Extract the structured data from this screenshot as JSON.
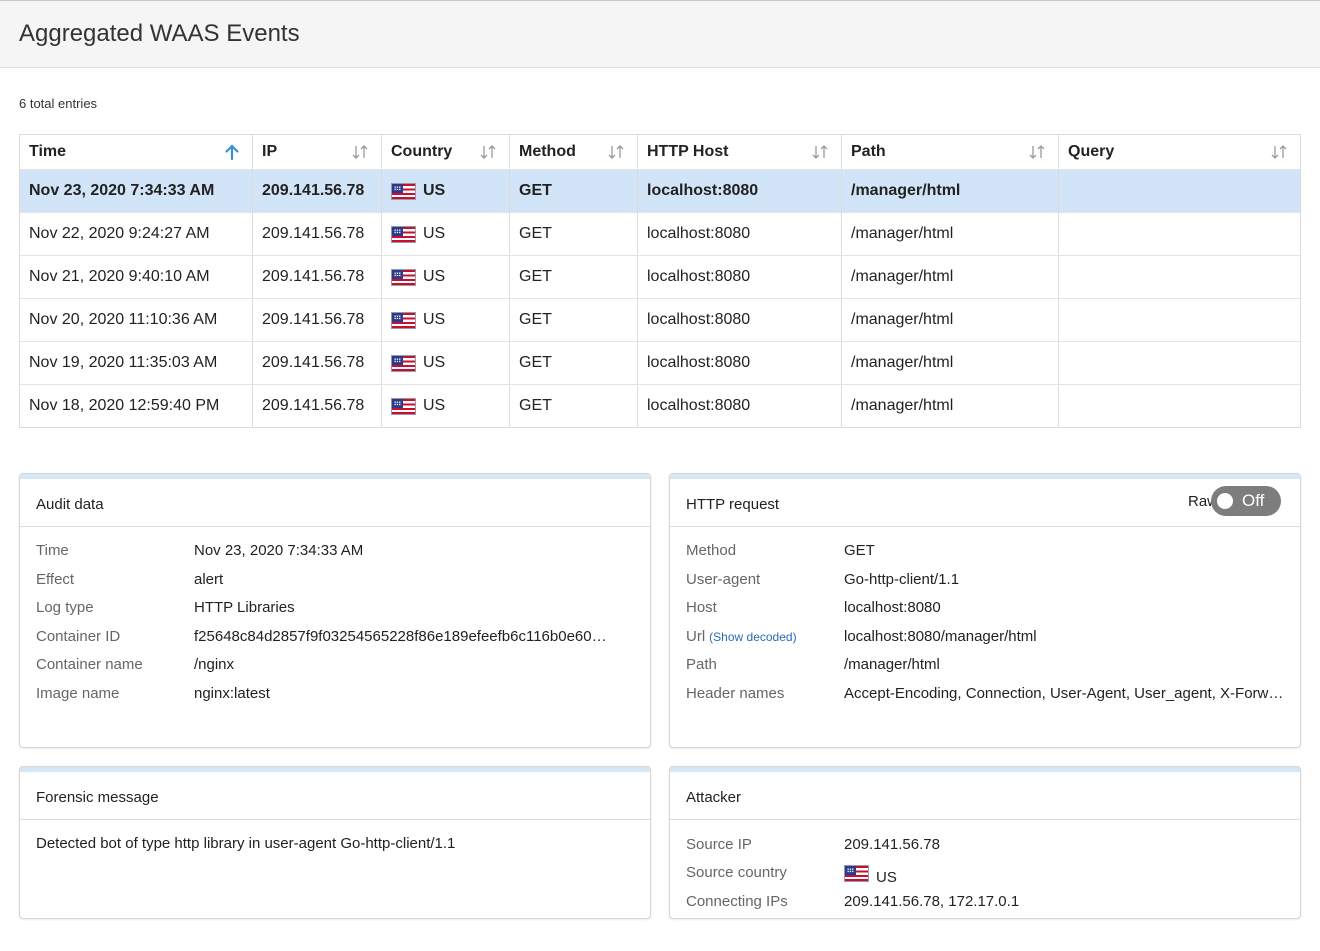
{
  "header": {
    "title": "Aggregated WAAS Events"
  },
  "entries_text": "6 total entries",
  "table": {
    "columns": [
      "Time",
      "IP",
      "Country",
      "Method",
      "HTTP Host",
      "Path",
      "Query"
    ],
    "rows": [
      {
        "time": "Nov 23, 2020 7:34:33 AM",
        "ip": "209.141.56.78",
        "country": "US",
        "method": "GET",
        "host": "localhost:8080",
        "path": "/manager/html",
        "query": ""
      },
      {
        "time": "Nov 22, 2020 9:24:27 AM",
        "ip": "209.141.56.78",
        "country": "US",
        "method": "GET",
        "host": "localhost:8080",
        "path": "/manager/html",
        "query": ""
      },
      {
        "time": "Nov 21, 2020 9:40:10 AM",
        "ip": "209.141.56.78",
        "country": "US",
        "method": "GET",
        "host": "localhost:8080",
        "path": "/manager/html",
        "query": ""
      },
      {
        "time": "Nov 20, 2020 11:10:36 AM",
        "ip": "209.141.56.78",
        "country": "US",
        "method": "GET",
        "host": "localhost:8080",
        "path": "/manager/html",
        "query": ""
      },
      {
        "time": "Nov 19, 2020 11:35:03 AM",
        "ip": "209.141.56.78",
        "country": "US",
        "method": "GET",
        "host": "localhost:8080",
        "path": "/manager/html",
        "query": ""
      },
      {
        "time": "Nov 18, 2020 12:59:40 PM",
        "ip": "209.141.56.78",
        "country": "US",
        "method": "GET",
        "host": "localhost:8080",
        "path": "/manager/html",
        "query": ""
      }
    ]
  },
  "audit": {
    "title": "Audit data",
    "fields": [
      {
        "label": "Time",
        "value": "Nov 23, 2020 7:34:33 AM"
      },
      {
        "label": "Effect",
        "value": "alert"
      },
      {
        "label": "Log type",
        "value": "HTTP Libraries"
      },
      {
        "label": "Container ID",
        "value": "f25648c84d2857f9f03254565228f86e189efeefb6c116b0e60…"
      },
      {
        "label": "Container name",
        "value": "/nginx"
      },
      {
        "label": "Image name",
        "value": "nginx:latest"
      }
    ]
  },
  "http_request": {
    "title": "HTTP request",
    "raw_label": "Raw",
    "toggle_label": "Off",
    "show_decoded": "(Show decoded)",
    "fields": [
      {
        "label": "Method",
        "value": "GET"
      },
      {
        "label": "User-agent",
        "value": "Go-http-client/1.1"
      },
      {
        "label": "Host",
        "value": "localhost:8080"
      },
      {
        "label": "Url",
        "value": "localhost:8080/manager/html"
      },
      {
        "label": "Path",
        "value": "/manager/html"
      },
      {
        "label": "Header names",
        "value": "Accept-Encoding, Connection, User-Agent, User_agent, X-Forw…"
      }
    ]
  },
  "forensic": {
    "title": "Forensic message",
    "message": "Detected bot of type http library in user-agent Go-http-client/1.1"
  },
  "attacker": {
    "title": "Attacker",
    "fields": [
      {
        "label": "Source IP",
        "value": "209.141.56.78"
      },
      {
        "label": "Source country",
        "value": "US"
      },
      {
        "label": "Connecting IPs",
        "value": "209.141.56.78, 172.17.0.1"
      }
    ]
  },
  "colors": {
    "selected_row": "#d2e4f7",
    "accent": "#3b8fd9",
    "panel_strip": "#d6e7f7",
    "toggle_off": "#7d7d7d"
  }
}
